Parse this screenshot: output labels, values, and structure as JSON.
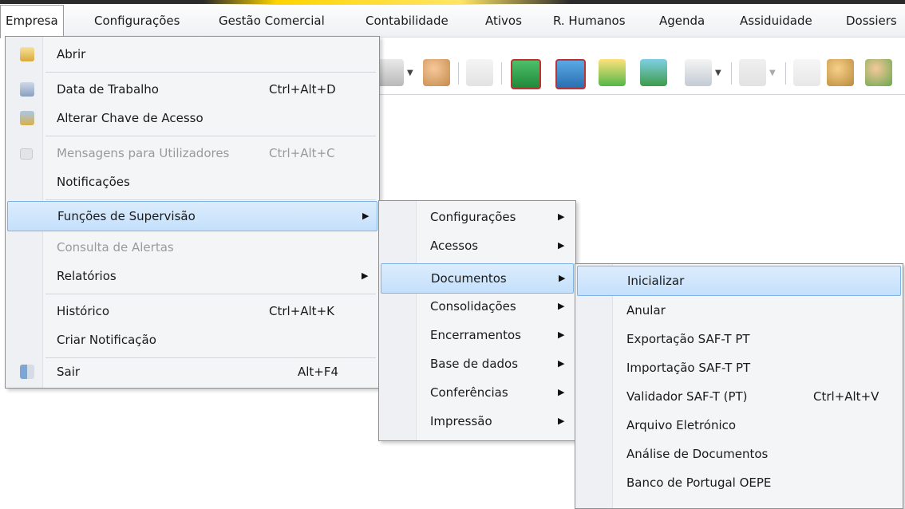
{
  "menubar": {
    "items": [
      "Empresa",
      "Configurações",
      "Gestão Comercial",
      "Contabilidade",
      "Ativos",
      "R. Humanos",
      "Agenda",
      "Assiduidade",
      "Dossiers"
    ]
  },
  "empresa_menu": {
    "items": [
      {
        "label": "Abrir",
        "shortcut": "",
        "icon": "folder-open-icon"
      },
      {
        "label": "Data de Trabalho",
        "shortcut": "Ctrl+Alt+D",
        "icon": "calendar-icon"
      },
      {
        "label": "Alterar Chave de Acesso",
        "shortcut": "",
        "icon": "key-icon"
      },
      {
        "label": "Mensagens para Utilizadores",
        "shortcut": "Ctrl+Alt+C",
        "icon": "message-icon",
        "disabled": true
      },
      {
        "label": "Notificações",
        "shortcut": ""
      },
      {
        "label": "Funções de Supervisão",
        "shortcut": "",
        "submenu": true,
        "highlighted": true
      },
      {
        "label": "Consulta de Alertas",
        "shortcut": "",
        "disabled": true
      },
      {
        "label": "Relatórios",
        "shortcut": "",
        "submenu": true
      },
      {
        "label": "Histórico",
        "shortcut": "Ctrl+Alt+K"
      },
      {
        "label": "Criar Notificação",
        "shortcut": ""
      },
      {
        "label": "Sair",
        "shortcut": "Alt+F4",
        "icon": "exit-icon"
      }
    ]
  },
  "supervisao_menu": {
    "items": [
      "Configurações",
      "Acessos",
      "Documentos",
      "Consolidações",
      "Encerramentos",
      "Base de dados",
      "Conferências",
      "Impressão"
    ],
    "highlighted": "Documentos"
  },
  "documentos_menu": {
    "items": [
      {
        "label": "Inicializar",
        "shortcut": "",
        "highlighted": true
      },
      {
        "label": "Anular",
        "shortcut": ""
      },
      {
        "label": "Exportação SAF-T PT",
        "shortcut": ""
      },
      {
        "label": "Importação SAF-T PT",
        "shortcut": ""
      },
      {
        "label": "Validador SAF-T (PT)",
        "shortcut": "Ctrl+Alt+V"
      },
      {
        "label": "Arquivo Eletrónico",
        "shortcut": ""
      },
      {
        "label": "Análise de Documentos",
        "shortcut": ""
      },
      {
        "label": "Banco de Portugal OEPE",
        "shortcut": ""
      }
    ]
  },
  "submenu_arrow": "▶",
  "colors": {
    "highlight": "#c4e0fc",
    "highlight_border": "#7fb2e6",
    "disabled": "#9a9a9a"
  }
}
